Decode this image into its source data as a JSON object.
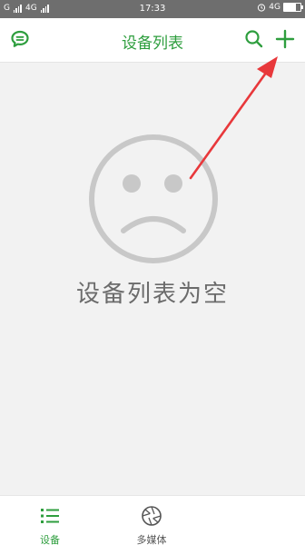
{
  "status_bar": {
    "carrier_left": "G",
    "network": "4G",
    "time": "17:33",
    "network_right": "4G",
    "colors": {
      "background": "#6e6e6e",
      "text": "#ffffff"
    }
  },
  "header": {
    "title": "设备列表",
    "left_icon": "chat-bubble-icon",
    "search_icon": "search-icon",
    "add_icon": "plus-icon",
    "accent_color": "#2e9e3e"
  },
  "empty_state": {
    "icon": "sad-face-icon",
    "message": "设备列表为空"
  },
  "annotation": {
    "icon": "red-arrow-icon",
    "color": "#e8383b"
  },
  "bottom_nav": {
    "items": [
      {
        "label": "设备",
        "icon": "list-icon",
        "active": true
      },
      {
        "label": "多媒体",
        "icon": "aperture-icon",
        "active": false
      }
    ],
    "active_color": "#2e9e3e",
    "inactive_color": "#555555"
  }
}
